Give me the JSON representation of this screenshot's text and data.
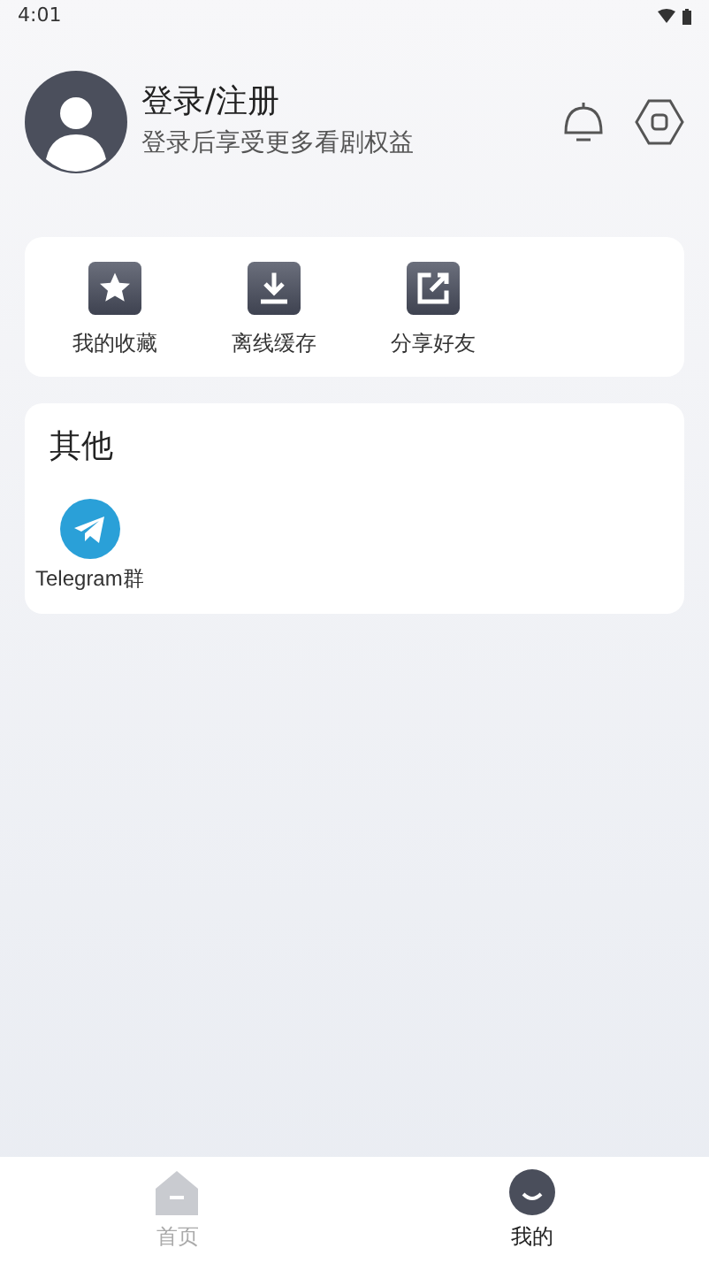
{
  "status_bar": {
    "time": "4:01"
  },
  "profile": {
    "title": "登录/注册",
    "subtitle": "登录后享受更多看剧权益"
  },
  "quick_actions": [
    {
      "kind": "star",
      "label": "我的收藏"
    },
    {
      "kind": "download",
      "label": "离线缓存"
    },
    {
      "kind": "share",
      "label": "分享好友"
    }
  ],
  "other": {
    "title": "其他",
    "items": [
      {
        "kind": "telegram",
        "label": "Telegram群"
      }
    ]
  },
  "tabs": [
    {
      "kind": "home",
      "label": "首页",
      "selected": false
    },
    {
      "kind": "profile",
      "label": "我的",
      "selected": true
    }
  ]
}
